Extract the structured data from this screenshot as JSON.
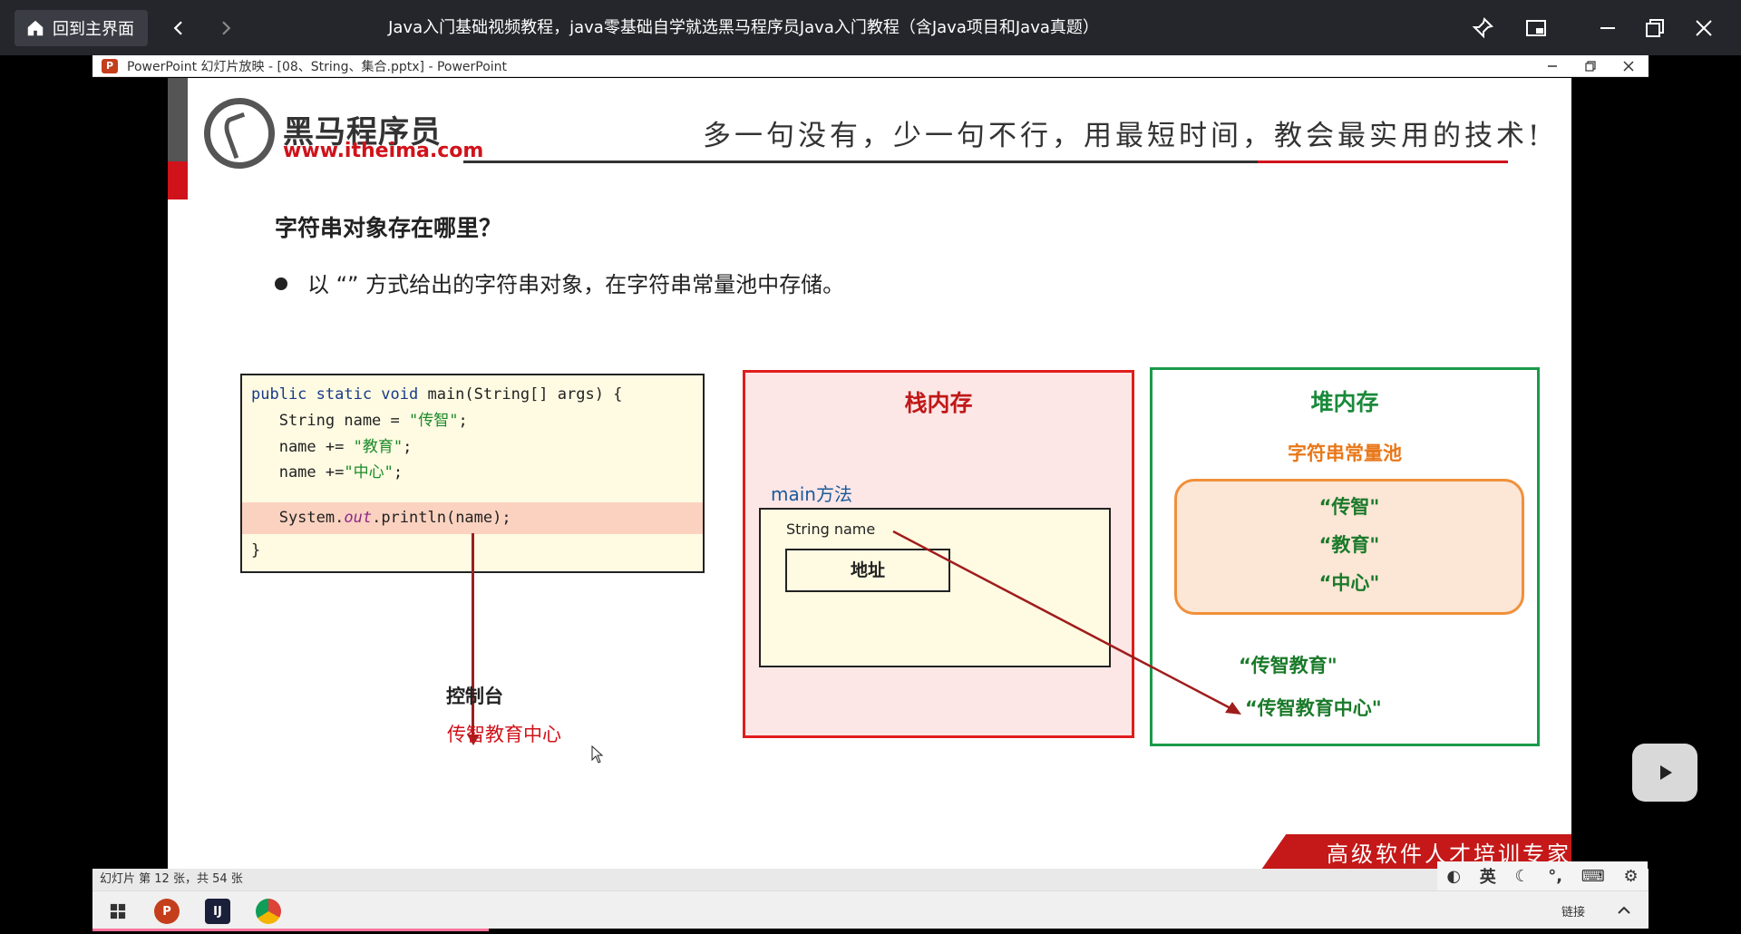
{
  "window": {
    "home_label": "回到主界面",
    "title": "Java入门基础视频教程，java零基础自学就选黑马程序员Java入门教程（含Java项目和Java真题）"
  },
  "ppt": {
    "window_title": "PowerPoint 幻灯片放映 - [08、String、集合.pptx] - PowerPoint",
    "status": "幻灯片 第 12 张，共 54 张"
  },
  "slide": {
    "logo_cn": "黑马程序员",
    "logo_url": "www.itheima.com",
    "slogan": "多一句没有，少一句不行，用最短时间，教会最实用的技术!",
    "heading": "字符串对象存在哪里？",
    "bullet": "以 “” 方式给出的字符串对象，在字符串常量池中存储。",
    "code": {
      "l1_kw": "public static void",
      "l1_rest": " main(String[] args) {",
      "l2_pre": "   String name = ",
      "l2_str": "\"传智\"",
      "l2_end": ";",
      "l3_pre": "   name += ",
      "l3_str": "\"教育\"",
      "l3_end": ";",
      "l4_pre": "   name +=",
      "l4_str": "\"中心\"",
      "l4_end": ";",
      "l5_pre": "   System.",
      "l5_out": "out",
      "l5_end": ".println(name);",
      "l6": "}"
    },
    "console_label": "控制台",
    "console_output": "传智教育中心",
    "stack": {
      "title": "栈内存",
      "method": "main方法",
      "var": "String name",
      "address": "地址"
    },
    "heap": {
      "title": "堆内存",
      "pool_title": "字符串常量池",
      "pool_items": [
        "“传智\"",
        "“教育\"",
        "“中心\""
      ],
      "item1": "“传智教育\"",
      "item2": "“传智教育中心\""
    },
    "banner": "高级软件人才培训专家"
  },
  "taskbar": {
    "tray": "链接"
  },
  "overlay": {
    "lang": "英"
  },
  "colors": {
    "brand_red": "#d0121b",
    "stack_border": "#e11d1d",
    "heap_border": "#1a9a4a",
    "pool_border": "#f0903a",
    "progress": "#fb7299"
  }
}
